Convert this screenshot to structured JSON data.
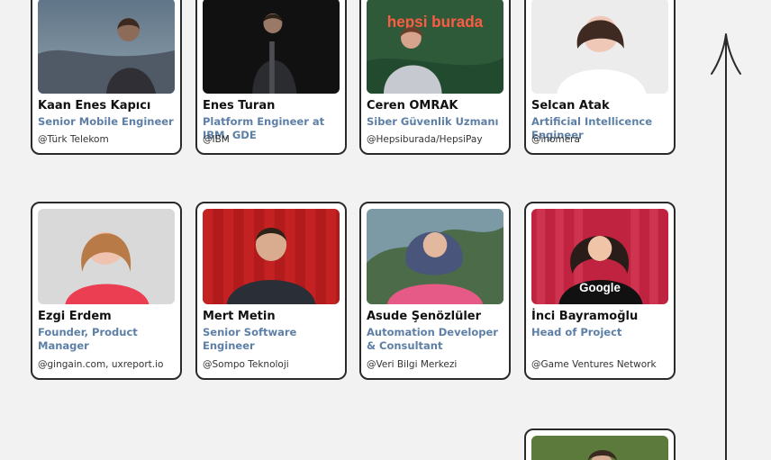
{
  "speakers": [
    {
      "name": "Kaan Enes Kapıcı",
      "role": "Senior Mobile Engineer",
      "org": "@Türk Telekom"
    },
    {
      "name": "Enes Turan",
      "role": "Platform Engineer at IBM, GDE",
      "org": "@IBM"
    },
    {
      "name": "Ceren OMRAK",
      "role": "Siber Güvenlik Uzmanı",
      "org": "@Hepsiburada/HepsiPay",
      "photo_sign": "hepsi burada"
    },
    {
      "name": "Selcan Atak",
      "role": "Artificial Intellicence Engineer",
      "org": "@inomera"
    },
    {
      "name": "Ezgi Erdem",
      "role": "Founder, Product Manager",
      "org": "@gingain.com, uxreport.io"
    },
    {
      "name": "Mert Metin",
      "role": "Senior Software Engineer",
      "org": "@Sompo Teknoloji"
    },
    {
      "name": "Asude Şenözlüler",
      "role": "Automation Developer & Consultant",
      "org": "@Veri Bilgi Merkezi"
    },
    {
      "name": "İnci Bayramoğlu",
      "role": "Head of Project",
      "org": "@Game Ventures Network",
      "shirt_text": "Google"
    }
  ],
  "colors": {
    "role_text": "#5d7fa5",
    "card_border": "#2a2a2a",
    "background": "#f2f2f2"
  },
  "icons": {
    "timeline": "up-arrow-icon"
  }
}
